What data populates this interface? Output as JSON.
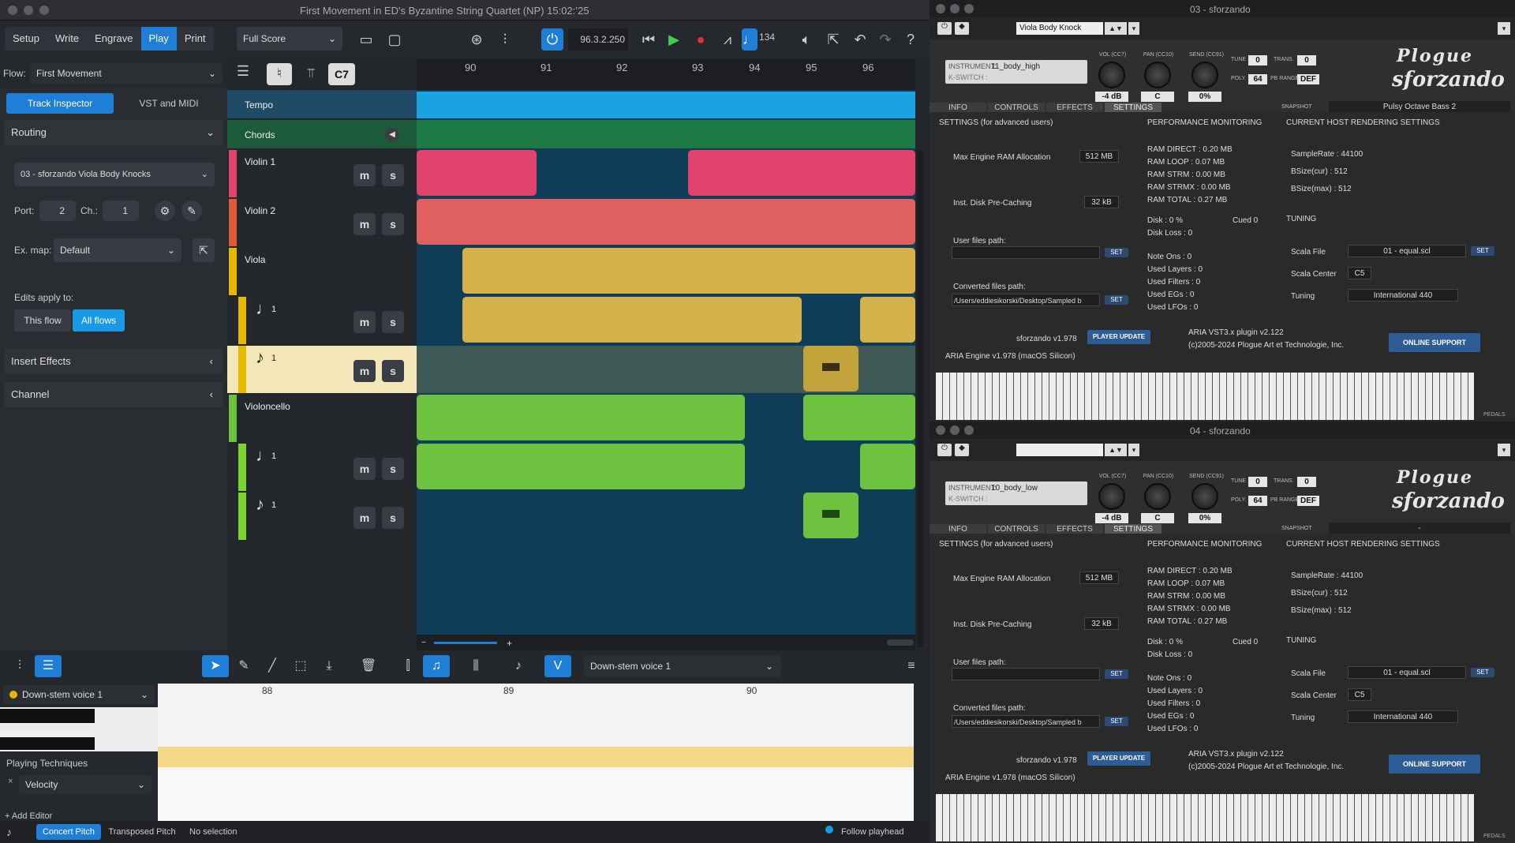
{
  "window_title": "First Movement in ED's Byzantine String Quartet (NP) 15:02:’25",
  "modes": [
    "Setup",
    "Write",
    "Engrave",
    "Play",
    "Print"
  ],
  "active_mode": "Play",
  "layout": "Full Score",
  "time_display": "96.3.2.250",
  "tempo_value": "134",
  "flow_label": "Flow:",
  "flow_value": "First Movement",
  "chord_symbol": "C7",
  "inspector_tabs": [
    "Track Inspector",
    "VST and MIDI"
  ],
  "routing_label": "Routing",
  "routing_value": "03 - sforzando Viola Body Knocks",
  "port_label": "Port:",
  "port_value": "2",
  "ch_label": "Ch.:",
  "ch_value": "1",
  "exmap_label": "Ex. map:",
  "exmap_value": "Default",
  "edits_apply_label": "Edits apply to:",
  "edits_options": [
    "This flow",
    "All flows"
  ],
  "insert_effects": "Insert Effects",
  "channel": "Channel",
  "ruler_bars": [
    "90",
    "91",
    "92",
    "93",
    "94",
    "95",
    "96"
  ],
  "tracks": {
    "tempo": "Tempo",
    "chords": "Chords",
    "violin1": "Violin 1",
    "violin2": "Violin 2",
    "viola": "Viola",
    "viola_v1": "1",
    "viola_v2": "1",
    "cello": "Violoncello",
    "cello_v1": "1",
    "cello_v2": "1"
  },
  "mute_label": "m",
  "solo_label": "s",
  "bottom_voice": "Down-stem voice 1",
  "editor_voice": "Down-stem voice 1",
  "editor_bars": [
    "88",
    "89",
    "90"
  ],
  "playing_techniques": "Playing Techniques",
  "velocity": "Velocity",
  "add_editor": "+ Add Editor",
  "status": {
    "concert_pitch": "Concert Pitch",
    "transposed_pitch": "Transposed Pitch",
    "selection": "No selection",
    "follow": "Follow playhead"
  },
  "sfz_instances": [
    {
      "title": "03 - sforzando",
      "snapshot_combo": "Viola Body Knock",
      "instrument_label": "INSTRUMENT:",
      "instrument": "11_body_high",
      "kswitch": "K-SWITCH :",
      "vol_label": "VOL (CC7)",
      "vol": "-4 dB",
      "pan_label": "PAN (CC10)",
      "pan": "C",
      "send_label": "SEND (CC91)",
      "send": "0%",
      "tune_label": "TUNE",
      "tune": "0",
      "trans_label": "TRANS.",
      "trans": "0",
      "poly_label": "POLY.",
      "poly": "64",
      "pbrange_label": "PB RANGE",
      "pbrange": "DEF",
      "tabs": [
        "INFO",
        "CONTROLS",
        "EFFECTS",
        "SETTINGS"
      ],
      "snapshot_label": "SNAPSHOT",
      "snapshot": "Pulsy Octave Bass 2",
      "settings_title": "SETTINGS (for advanced users)",
      "ram_alloc_label": "Max Engine RAM Allocation",
      "ram_alloc": "512 MB",
      "disk_precache_label": "Inst. Disk Pre-Caching",
      "disk_precache": "32 kB",
      "user_files_label": "User files path:",
      "converted_label": "Converted files path:",
      "converted_path": "/Users/eddiesikorski/Desktop/Sampled b",
      "set": "SET",
      "perf_title": "PERFORMANCE MONITORING",
      "perf": [
        "RAM DIRECT : 0.20 MB",
        "RAM LOOP   : 0.07 MB",
        "RAM STRM   : 0.00 MB",
        "RAM STRMX : 0.00 MB",
        "RAM TOTAL  : 0.27 MB"
      ],
      "disk_line": "Disk        :   0 %",
      "cued": "Cued 0",
      "disk_loss": "Disk Loss   :   0",
      "counts": [
        "Note Ons      :   0",
        "Used Layers  :   0",
        "Used Filters  :   0",
        "Used EGs      :   0",
        "Used LFOs     :   0"
      ],
      "host_title": "CURRENT HOST RENDERING SETTINGS",
      "host": [
        "SampleRate   : 44100",
        "BSize(cur)     :   512",
        "BSize(max)    :   512"
      ],
      "tuning_title": "TUNING",
      "scala_file_label": "Scala File",
      "scala_file": "01 - equal.scl",
      "scala_center_label": "Scala Center",
      "scala_center": "C5",
      "tuning_label": "Tuning",
      "tuning": "International 440",
      "sfz_version": "sforzando v1.978",
      "player_update": "PLAYER UPDATE",
      "aria_plugin": "ARIA VST3.x plugin v2.122",
      "copyright": "(c)2005-2024 Plogue Art et Technologie, Inc.",
      "online_support": "ONLINE SUPPORT",
      "aria_engine": "ARIA Engine v1.978 (macOS Silicon)",
      "pedals": "PEDALS"
    },
    {
      "title": "04 - sforzando",
      "snapshot_combo": "",
      "instrument_label": "INSTRUMENT:",
      "instrument": "10_body_low",
      "kswitch": "K-SWITCH :",
      "vol_label": "VOL (CC7)",
      "vol": "-4 dB",
      "pan_label": "PAN (CC10)",
      "pan": "C",
      "send_label": "SEND (CC91)",
      "send": "0%",
      "tune_label": "TUNE",
      "tune": "0",
      "trans_label": "TRANS.",
      "trans": "0",
      "poly_label": "POLY.",
      "poly": "64",
      "pbrange_label": "PB RANGE",
      "pbrange": "DEF",
      "tabs": [
        "INFO",
        "CONTROLS",
        "EFFECTS",
        "SETTINGS"
      ],
      "snapshot_label": "SNAPSHOT",
      "snapshot": "-",
      "settings_title": "SETTINGS (for advanced users)",
      "ram_alloc_label": "Max Engine RAM Allocation",
      "ram_alloc": "512 MB",
      "disk_precache_label": "Inst. Disk Pre-Caching",
      "disk_precache": "32 kB",
      "user_files_label": "User files path:",
      "converted_label": "Converted files path:",
      "converted_path": "/Users/eddiesikorski/Desktop/Sampled b",
      "set": "SET",
      "perf_title": "PERFORMANCE MONITORING",
      "perf": [
        "RAM DIRECT : 0.20 MB",
        "RAM LOOP   : 0.07 MB",
        "RAM STRM   : 0.00 MB",
        "RAM STRMX : 0.00 MB",
        "RAM TOTAL  : 0.27 MB"
      ],
      "disk_line": "Disk        :   0 %",
      "cued": "Cued 0",
      "disk_loss": "Disk Loss   :   0",
      "counts": [
        "Note Ons      :   0",
        "Used Layers  :   0",
        "Used Filters  :   0",
        "Used EGs      :   0",
        "Used LFOs     :   0"
      ],
      "host_title": "CURRENT HOST RENDERING SETTINGS",
      "host": [
        "SampleRate   : 44100",
        "BSize(cur)     :   512",
        "BSize(max)    :   512"
      ],
      "tuning_title": "TUNING",
      "scala_file_label": "Scala File",
      "scala_file": "01 - equal.scl",
      "scala_center_label": "Scala Center",
      "scala_center": "C5",
      "tuning_label": "Tuning",
      "tuning": "International 440",
      "sfz_version": "sforzando v1.978",
      "player_update": "PLAYER UPDATE",
      "aria_plugin": "ARIA VST3.x plugin v2.122",
      "copyright": "(c)2005-2024 Plogue Art et Technologie, Inc.",
      "online_support": "ONLINE SUPPORT",
      "aria_engine": "ARIA Engine v1.978 (macOS Silicon)",
      "pedals": "PEDALS"
    }
  ],
  "colors": {
    "accent": "#1f7fd6",
    "violin1": "#e0436c",
    "violin2": "#e05a5a",
    "viola": "#d4b14a",
    "cello": "#6cc23e",
    "tempo": "#1aa3e0",
    "chords": "#1d7a45"
  }
}
